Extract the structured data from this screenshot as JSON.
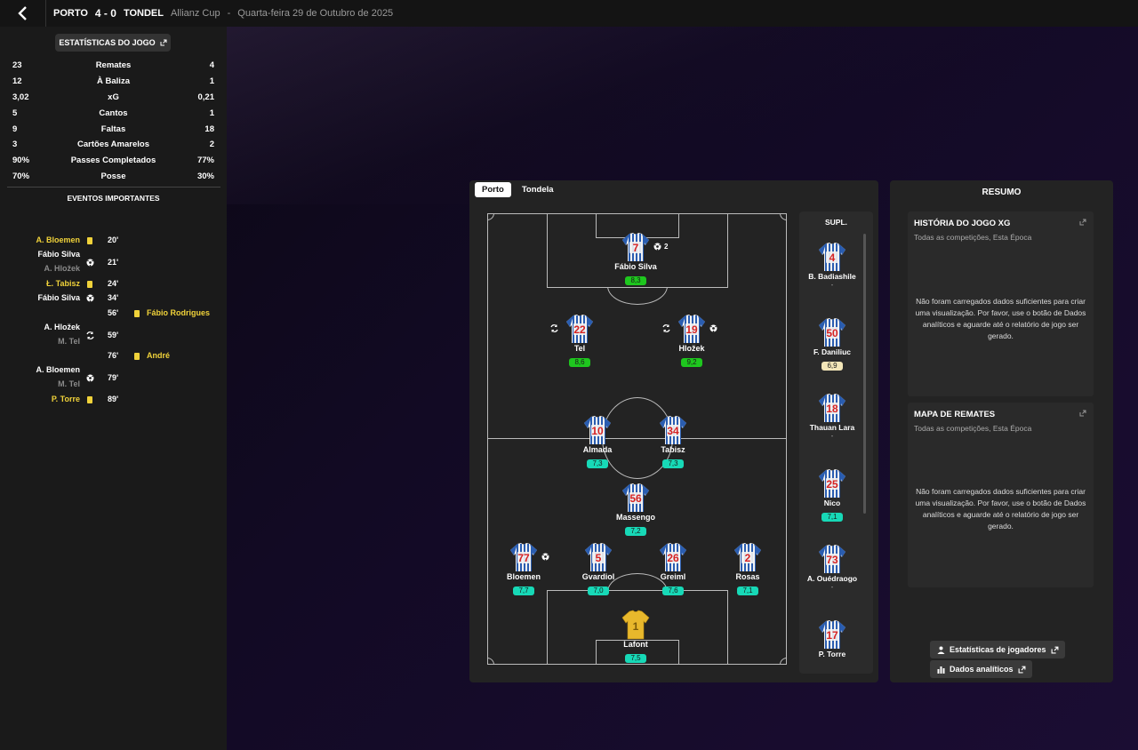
{
  "topbar": {
    "home": "PORTO",
    "score": "4 - 0",
    "away": "TONDEL",
    "competition": "Allianz Cup",
    "separator": "-",
    "date": "Quarta-feira 29 de Outubro de 2025"
  },
  "left": {
    "stats_button": "ESTATÍSTICAS DO JOGO",
    "stats": [
      {
        "home": "23",
        "label": "Remates",
        "away": "4"
      },
      {
        "home": "12",
        "label": "À Baliza",
        "away": "1"
      },
      {
        "home": "3,02",
        "label": "xG",
        "away": "0,21"
      },
      {
        "home": "5",
        "label": "Cantos",
        "away": "1"
      },
      {
        "home": "9",
        "label": "Faltas",
        "away": "18"
      },
      {
        "home": "3",
        "label": "Cartões Amarelos",
        "away": "2"
      },
      {
        "home": "90%",
        "label": "Passes Completados",
        "away": "77%"
      },
      {
        "home": "70%",
        "label": "Posse",
        "away": "30%"
      }
    ],
    "events_title": "EVENTOS IMPORTANTES",
    "events": [
      {
        "l1": "A. Bloemen",
        "min": "20'"
      },
      {
        "l1": "Fábio Silva",
        "l2": "A. Hložek",
        "min": "21'"
      },
      {
        "l1": "Ł. Tabisz",
        "min": "24'"
      },
      {
        "l1": "Fábio Silva",
        "min": "34'"
      },
      {
        "r1": "Fábio Rodrigues",
        "min": "56'"
      },
      {
        "l1": "A. Hložek",
        "l2": "M. Tel",
        "min": "59'"
      },
      {
        "r1": "André",
        "min": "76'"
      },
      {
        "l1": "A. Bloemen",
        "l2": "M. Tel",
        "min": "79'"
      },
      {
        "l1": "P. Torre",
        "min": "89'"
      }
    ]
  },
  "lineup": {
    "tabs": [
      "Porto",
      "Tondela"
    ],
    "players": [
      {
        "num": "7",
        "name": "Fábio Silva",
        "rating": "8,3",
        "goals": "2"
      },
      {
        "num": "22",
        "name": "Tel",
        "rating": "8,6"
      },
      {
        "num": "19",
        "name": "Hložek",
        "rating": "9,2"
      },
      {
        "num": "10",
        "name": "Almada",
        "rating": "7,3"
      },
      {
        "num": "34",
        "name": "Tabisz",
        "rating": "7,3"
      },
      {
        "num": "56",
        "name": "Massengo",
        "rating": "7,2"
      },
      {
        "num": "77",
        "name": "Bloemen",
        "rating": "7,7"
      },
      {
        "num": "5",
        "name": "Gvardiol",
        "rating": "7,0"
      },
      {
        "num": "26",
        "name": "Greiml",
        "rating": "7,6"
      },
      {
        "num": "2",
        "name": "Rosas",
        "rating": "7,1"
      },
      {
        "num": "1",
        "name": "Lafont",
        "rating": "7,5"
      }
    ],
    "subs_title": "SUPL.",
    "subs": [
      {
        "num": "4",
        "name": "B. Badiashile",
        "rating": "-"
      },
      {
        "num": "50",
        "name": "F. Daniliuc",
        "rating": "6,9"
      },
      {
        "num": "18",
        "name": "Thauan Lara",
        "rating": "-"
      },
      {
        "num": "25",
        "name": "Nico",
        "rating": "7,1"
      },
      {
        "num": "73",
        "name": "A. Ouédraogo",
        "rating": "-"
      },
      {
        "num": "17",
        "name": "P. Torre",
        "rating": ""
      }
    ]
  },
  "resumo": {
    "title": "RESUMO",
    "xg_title": "HISTÓRIA DO JOGO XG",
    "xg_sub": "Todas as competições, Esta Época",
    "xg_msg": "Não foram carregados dados suficientes para criar uma visualização. Por favor, use o botão de Dados analíticos e aguarde até o relatório de jogo ser gerado.",
    "shots_title": "MAPA DE REMATES",
    "shots_sub": "Todas as competições, Esta Época",
    "shots_msg": "Não foram carregados dados suficientes para criar uma visualização. Por favor, use o botão de Dados analíticos e aguarde até o relatório de jogo ser gerado.",
    "btn_players": "Estatísticas de jogadores",
    "btn_analytics": "Dados analíticos"
  },
  "colors": {
    "rating_green": "#1ec71e",
    "rating_teal": "#17d9b7",
    "card_yellow": "#f0d23a",
    "shirt_blue": "#2a5db0",
    "shirt_number": "#d62222"
  }
}
